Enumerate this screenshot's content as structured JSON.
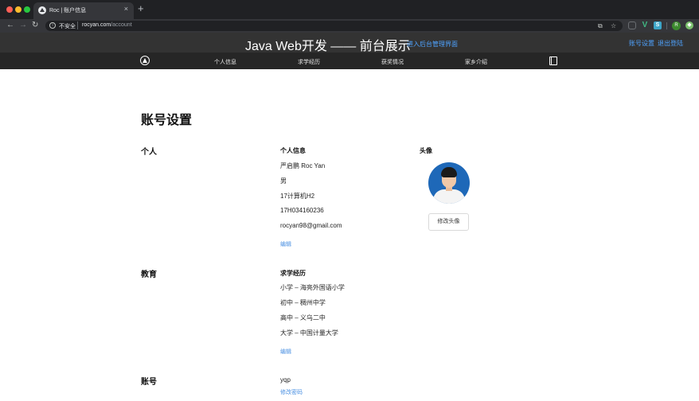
{
  "browser": {
    "tab_title": "Roc | 账户信息",
    "tab_close": "×",
    "new_tab": "+",
    "security_label": "不安全",
    "url_host": "rocyan.com",
    "url_path": "/account",
    "profile_initial": "R"
  },
  "header": {
    "title": "Java Web开发 —— 前台展示",
    "admin_link": "进入后台管理界面",
    "account_settings": "账号设置",
    "logout": "退出登陆"
  },
  "nav": {
    "items": [
      {
        "label": "个人信息"
      },
      {
        "label": "求学经历"
      },
      {
        "label": "获奖情况"
      },
      {
        "label": "家乡介绍"
      }
    ]
  },
  "page": {
    "title": "账号设置",
    "personal": {
      "label": "个人",
      "heading": "个人信息",
      "name": "严启鹏 Roc Yan",
      "gender": "男",
      "class": "17计算机H2",
      "student_id": "17H034160236",
      "email": "rocyan98@gmail.com",
      "edit": "编辑"
    },
    "avatar": {
      "heading": "头像",
      "change_button": "修改头像"
    },
    "education": {
      "label": "教育",
      "heading": "求学经历",
      "items": [
        "小学 – 海亮外国语小学",
        "初中 – 稠州中学",
        "高中 – 义乌二中",
        "大学 – 中国计量大学"
      ],
      "edit": "编辑"
    },
    "account": {
      "label": "账号",
      "username": "yqp",
      "change_password": "修改密码"
    }
  }
}
